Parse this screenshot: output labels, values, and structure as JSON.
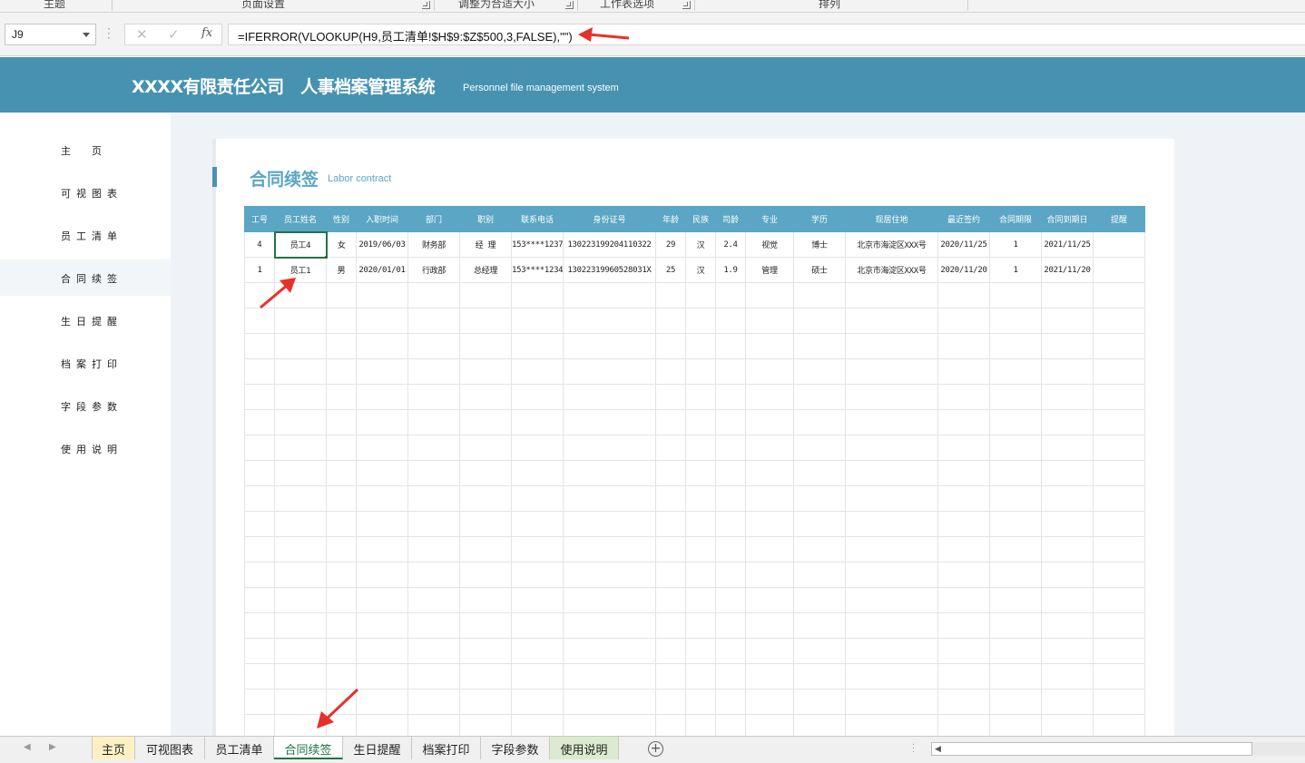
{
  "ribbon": {
    "groups": [
      "主题",
      "页面设置",
      "调整为合适大小",
      "工作表选项",
      "排列"
    ]
  },
  "formula_bar": {
    "name_box": "J9",
    "cancel_icon": "✕",
    "enter_icon": "✓",
    "fx_label": "fx",
    "formula": "=IFERROR(VLOOKUP(H9,员工清单!$H$9:$Z$500,3,FALSE),\"\")"
  },
  "header": {
    "title": "XXXX有限责任公司　人事档案管理系统",
    "subtitle": "Personnel file management system"
  },
  "sidebar": {
    "items": [
      {
        "label": "主　页"
      },
      {
        "label": "可视图表"
      },
      {
        "label": "员工清单"
      },
      {
        "label": "合同续签"
      },
      {
        "label": "生日提醒"
      },
      {
        "label": "档案打印"
      },
      {
        "label": "字段参数"
      },
      {
        "label": "使用说明"
      }
    ],
    "active_index": 3
  },
  "section": {
    "title": "合同续签",
    "subtitle": "Labor contract"
  },
  "table": {
    "headers": [
      "工号",
      "员工姓名",
      "性别",
      "入职时间",
      "部门",
      "职别",
      "联系电话",
      "身份证号",
      "年龄",
      "民族",
      "司龄",
      "专业",
      "学历",
      "现居住地",
      "最近签约",
      "合同期限",
      "合同到期日",
      "提醒"
    ],
    "rows": [
      [
        "4",
        "员工4",
        "女",
        "2019/06/03",
        "财务部",
        "经 理",
        "153****1237",
        "130223199204110322",
        "29",
        "汉",
        "2.4",
        "视觉",
        "博士",
        "北京市海淀区XXX号",
        "2020/11/25",
        "1",
        "2021/11/25",
        ""
      ],
      [
        "1",
        "员工1",
        "男",
        "2020/01/01",
        "行政部",
        "总经理",
        "153****1234",
        "13022319960528031X",
        "25",
        "汉",
        "1.9",
        "管理",
        "硕士",
        "北京市海淀区XXX号",
        "2020/11/20",
        "1",
        "2021/11/20",
        ""
      ]
    ],
    "empty_rows": 18
  },
  "sheet_tabs": {
    "tabs": [
      "主页",
      "可视图表",
      "员工清单",
      "合同续签",
      "生日提醒",
      "档案打印",
      "字段参数",
      "使用说明"
    ],
    "active": "合同续签",
    "add_icon": "+"
  },
  "colors": {
    "banner": "#4692b0",
    "accent": "#5aa6c4",
    "excel_green": "#217346",
    "annotation_arrow": "#e8302a"
  }
}
